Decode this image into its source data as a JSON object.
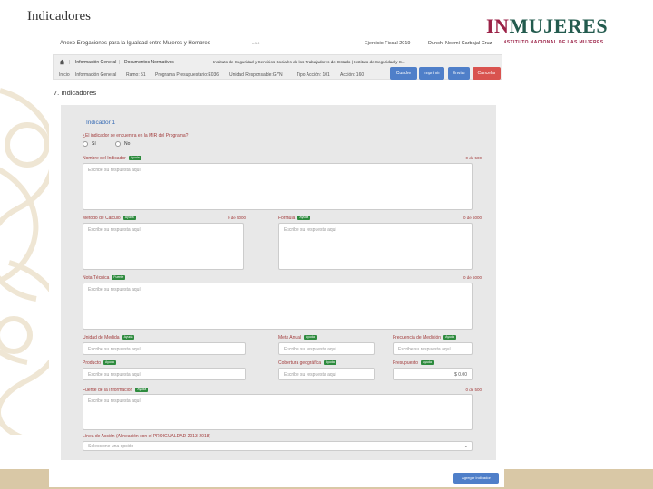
{
  "slide": {
    "title": "Indicadores",
    "brand_in": "IN",
    "brand_mujeres": "MUJERES",
    "brand_sub": "INSTITUTO NACIONAL DE LAS MUJERES"
  },
  "topbar": {
    "left_text": "Anexo Erogaciones para la Igualdad entre Mujeres y Hombres",
    "version": "v.1.0",
    "fiscal_year": "Ejercicio Fiscal 2019",
    "user": "Dunch. Noemí Carbajal Cruz"
  },
  "breadcrumb_top": {
    "item1": "Información General",
    "item2": "Documentos Normativos",
    "item3": "Instituto de Seguridad y Servicios Sociales de los Trabajadores del Estado | Instituto de Seguridad y S..."
  },
  "breadcrumb_bottom": {
    "item1": "Inicio",
    "item2": "Información General",
    "item3": "Ramo: 51",
    "item4": "Programa Presupuestario:E036",
    "item5": "Unidad Responsable:GYN",
    "item6": "Tipo Acción: 101",
    "item7": "Acción: 160"
  },
  "buttons": {
    "cuadre": "Cuadre",
    "imprimir": "Imprimir",
    "enviar": "Enviar",
    "cancelar": "Cancelar"
  },
  "section": {
    "title": "7. Indicadores"
  },
  "indicator": {
    "title": "Indicador 1",
    "question": "¿El indicador se encuentra en la MIR del Programa?",
    "option_yes": "Sí",
    "option_no": "No"
  },
  "fields": {
    "nombre": {
      "label": "Nombre del Indicador",
      "badge": "Ayuda",
      "counter": "0 de 500",
      "placeholder": "Escribe su respuesta aquí"
    },
    "metodo": {
      "label": "Método de Cálculo",
      "badge": "Ayuda",
      "counter": "0 de 5000",
      "placeholder": "Escribe su respuesta aquí"
    },
    "formula": {
      "label": "Fórmula",
      "badge": "Ayuda",
      "counter": "0 de 5000",
      "placeholder": "Escribe su respuesta aquí"
    },
    "nota": {
      "label": "Nota Técnica",
      "badge": "Fuente",
      "counter": "0 de 5000",
      "placeholder": "Escribe su respuesta aquí"
    },
    "unidad": {
      "label": "Unidad de Medida",
      "badge": "Ayuda",
      "placeholder": "Escribe su respuesta aquí"
    },
    "meta": {
      "label": "Meta Anual",
      "badge": "Ayuda",
      "placeholder": "Escribe su respuesta aquí"
    },
    "frecuencia": {
      "label": "Frecuencia de Medición",
      "badge": "Ayuda",
      "placeholder": "Escribe su respuesta aquí"
    },
    "producto": {
      "label": "Producto",
      "badge": "Ayuda",
      "placeholder": "Escribe su respuesta aquí"
    },
    "cobertura": {
      "label": "Cobertura geográfica",
      "badge": "Ayuda",
      "placeholder": "Escribe su respuesta aquí"
    },
    "presupuesto": {
      "label": "Presupuesto",
      "badge": "Ayuda",
      "value": "$ 0.00"
    },
    "fuente": {
      "label": "Fuente de la Información",
      "badge": "Ayuda",
      "counter": "0 de 500",
      "placeholder": "Escribe su respuesta aquí"
    },
    "linea": {
      "label": "Línea de Acción (Alineación con el PROIGUALDAD 2013-2018)",
      "placeholder": "Seleccione una opción"
    }
  },
  "submit": {
    "label": "Agregar Indicador"
  },
  "colors": {
    "label_red": "#a23c3c",
    "primary_blue": "#4f7fc9",
    "danger_red": "#d9534f",
    "badge_green": "#2e8b3e",
    "brand_wine": "#9b2247",
    "brand_green": "#235b4e"
  }
}
